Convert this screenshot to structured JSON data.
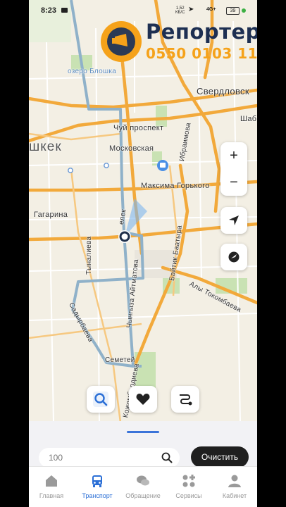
{
  "status_bar": {
    "time": "8:23",
    "network_speed": "1,52",
    "network_unit": "КБ/С",
    "signal": "4G+",
    "battery": "39"
  },
  "overlay_logo": {
    "name": "Репортер",
    "phone": "0550 0103 11"
  },
  "map": {
    "labels": {
      "lake": "озеро Блошка",
      "sverdlovsk": "Свердловск",
      "sha": "Шаб",
      "chui": "Чуй проспект",
      "bishkek": "шкек",
      "moskovskaya": "Московская",
      "ibraimova": "Ибраимова",
      "maksima": "Максима Горького",
      "gagarina": "Гагарина",
      "akhmatova": "Чынгыза Айтматова",
      "tynalieva": "Тыналиева",
      "baitik": "Байтик Баатыра",
      "tokombaeva": "Алы Токомбаева",
      "sadyrbaeva": "Садырбаева",
      "semetei": "Семетей",
      "koko": "Кожомбердиева",
      "elem": "елек"
    },
    "zoom_in": "+",
    "zoom_out": "−"
  },
  "bottom_sheet": {
    "search": {
      "placeholder": "100"
    },
    "clear_label": "Очистить"
  },
  "tabs": [
    {
      "label": "Главная",
      "icon": "home-icon",
      "active": false
    },
    {
      "label": "Транспорт",
      "icon": "bus-icon",
      "active": true
    },
    {
      "label": "Обращение",
      "icon": "chat-icon",
      "active": false
    },
    {
      "label": "Сервисы",
      "icon": "services-icon",
      "active": false
    },
    {
      "label": "Кабинет",
      "icon": "profile-icon",
      "active": false
    }
  ],
  "colors": {
    "accent": "#2b6fd6",
    "route": "#8fb1c9",
    "major_road": "#f2a93b",
    "logo_orange": "#f5a21a",
    "logo_navy": "#1d2f52"
  }
}
